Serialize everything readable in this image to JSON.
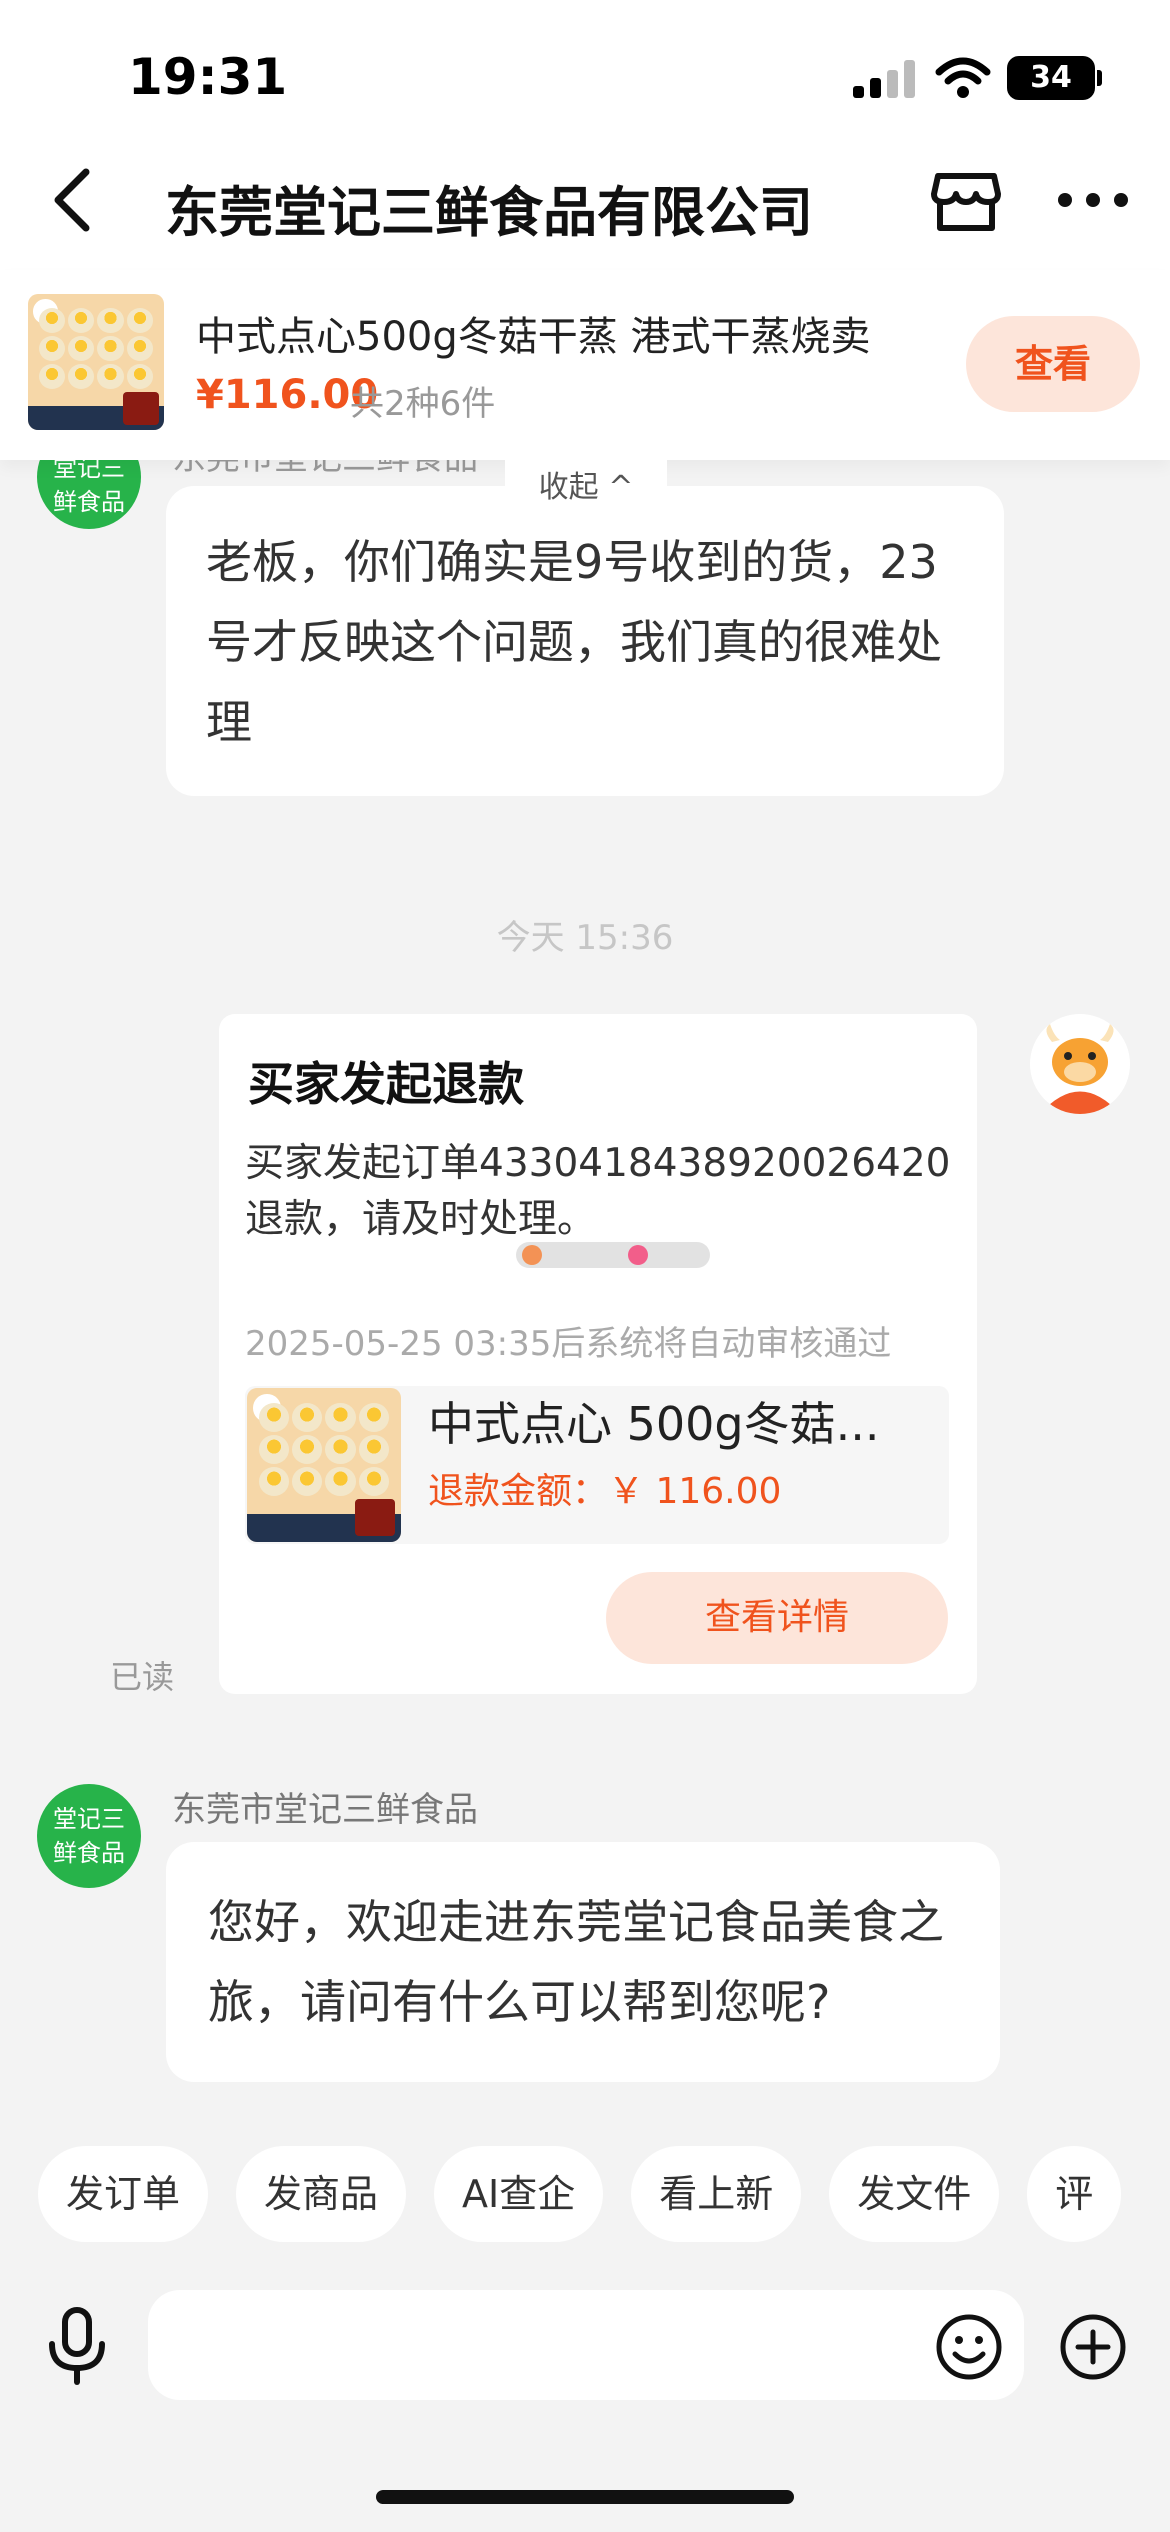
{
  "status_bar": {
    "time": "19:31",
    "battery": "34"
  },
  "nav": {
    "title": "东莞堂记三鲜食品有限公司"
  },
  "product_bar": {
    "title": "中式点心500g冬菇干蒸  港式干蒸烧卖",
    "price": "¥116.00",
    "count": "共2种6件",
    "button": "查看"
  },
  "messages": {
    "top_avatar_text": "堂记三\n鲜食品",
    "top_sender": "东莞市堂记三鲜食品",
    "collapse": "收起 ^",
    "first_bubble": "老板，你们确实是9号收到的货，23号才反映这个问题，我们真的很难处理",
    "time_separator": "今天 15:36",
    "read_status": "已读",
    "bottom_avatar_text": "堂记三\n鲜食品",
    "bottom_sender": "东莞市堂记三鲜食品",
    "last_bubble": "您好，欢迎走进东莞堂记食品美食之旅，请问有什么可以帮到您呢?"
  },
  "refund_card": {
    "title": "买家发起退款",
    "body": "买家发起订单4330418438920026420退款，请及时处理。",
    "deadline": "2025-05-25 03:35后系统将自动审核通过",
    "product_name": "中式点心 500g冬菇...",
    "refund_amount": "退款金额：￥ 116.00",
    "detail_button": "查看详情"
  },
  "quick_actions": [
    "发订单",
    "发商品",
    "AI查企",
    "看上新",
    "发文件",
    "评"
  ],
  "input": {
    "placeholder": ""
  },
  "icons": [
    "back-icon",
    "store-icon",
    "more-icon",
    "mic-icon",
    "emoji-icon",
    "plus-icon"
  ],
  "colors": {
    "accent": "#f0531d",
    "accent_light": "#fde5da",
    "avatar_green": "#27b34a",
    "background": "#f3f3f3"
  }
}
